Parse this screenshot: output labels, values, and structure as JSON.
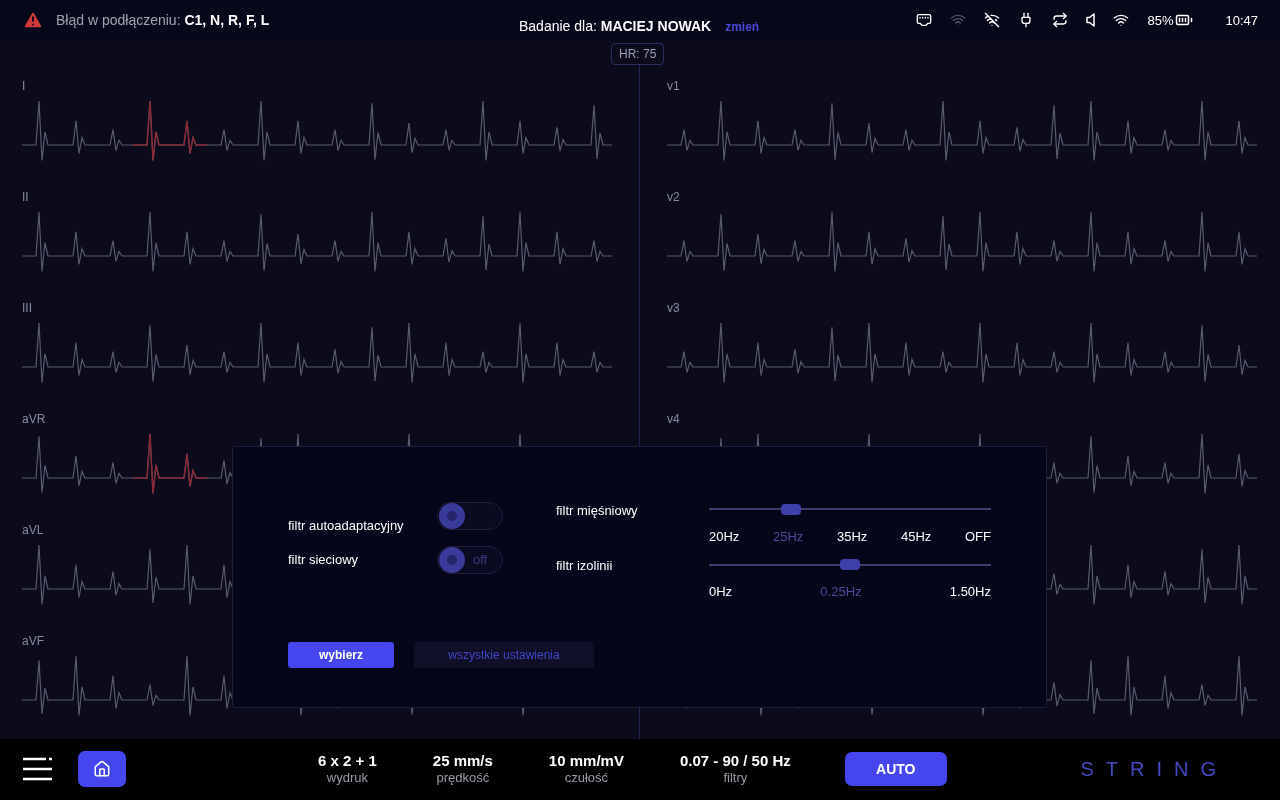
{
  "top_bar": {
    "error_label": "Błąd w podłączeniu:",
    "error_leads": "C1, N, R, F, L",
    "patient_label": "Badanie dla:",
    "patient_name": "MACIEJ NOWAK",
    "change_link": "zmień",
    "battery": "85%",
    "time": "10:47"
  },
  "hr_badge": "HR: 75",
  "leads_left": [
    {
      "label": "I",
      "fault": true
    },
    {
      "label": "II",
      "fault": false
    },
    {
      "label": "III",
      "fault": false
    },
    {
      "label": "aVR",
      "fault": true
    },
    {
      "label": "aVL",
      "fault": false
    },
    {
      "label": "aVF",
      "fault": false
    }
  ],
  "leads_right": [
    {
      "label": "v1"
    },
    {
      "label": "v2"
    },
    {
      "label": "v3"
    },
    {
      "label": "v4"
    }
  ],
  "filter_dialog": {
    "toggles": [
      {
        "label": "filtr autoadaptacyjny",
        "on": false
      },
      {
        "label": "filtr sieciowy",
        "on": false,
        "state_text": "off"
      }
    ],
    "sliders": [
      {
        "label": "filtr mięśniowy",
        "level": 0.29,
        "ticks": [
          {
            "label": "20Hz",
            "selected": false
          },
          {
            "label": "25Hz",
            "selected": true
          },
          {
            "label": "35Hz",
            "selected": false
          },
          {
            "label": "45Hz",
            "selected": false
          },
          {
            "label": "OFF",
            "selected": false
          }
        ]
      },
      {
        "label": "filtr izolinii",
        "level": 0.5,
        "ticks": [
          {
            "label": "0Hz",
            "selected": false
          },
          {
            "label": "0.25Hz",
            "selected": true
          },
          {
            "label": "1.50Hz",
            "selected": false
          }
        ]
      }
    ],
    "primary_button": "wybierz",
    "secondary_button": "wszystkie ustawienia"
  },
  "bottom_bar": {
    "stats": [
      {
        "value": "6 x 2 + 1",
        "label": "wydruk"
      },
      {
        "value": "25 mm/s",
        "label": "prędkość"
      },
      {
        "value": "10 mm/mV",
        "label": "czułość"
      },
      {
        "value": "0.07 - 90 / 50 Hz",
        "label": "filtry"
      }
    ],
    "auto_button": "AUTO",
    "logo": "STRING"
  }
}
